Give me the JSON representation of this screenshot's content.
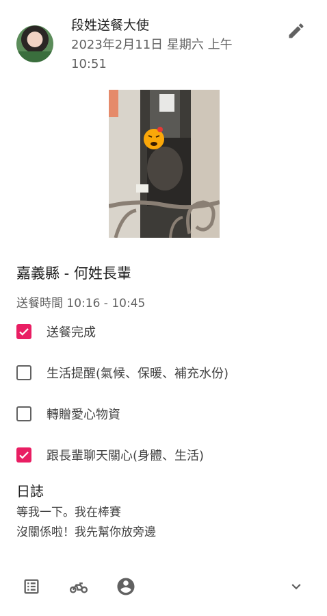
{
  "post": {
    "author": "段姓送餐大使",
    "datetime": "2023年2月11日 星期六 上午10:51",
    "edit_icon": "pencil-icon"
  },
  "entry": {
    "title": "嘉義縣 - 何姓長輩",
    "time_label": "送餐時間",
    "time_range": "10:16 - 10:45"
  },
  "checklist": [
    {
      "label": "送餐完成",
      "checked": true
    },
    {
      "label": "生活提醒(氣候、保暖、補充水份)",
      "checked": false
    },
    {
      "label": "轉贈愛心物資",
      "checked": false
    },
    {
      "label": "跟長輩聊天關心(身體、生活)",
      "checked": true
    }
  ],
  "log": {
    "title": "日誌",
    "lines": [
      "等我一下。我在棒賽",
      "沒關係啦！我先幫你放旁邊"
    ]
  },
  "colors": {
    "accent": "#e91e63",
    "icon": "#616161"
  },
  "bottom_bar": [
    "list-icon",
    "motorbike-icon",
    "account-circle-icon",
    "chevron-down-icon"
  ]
}
